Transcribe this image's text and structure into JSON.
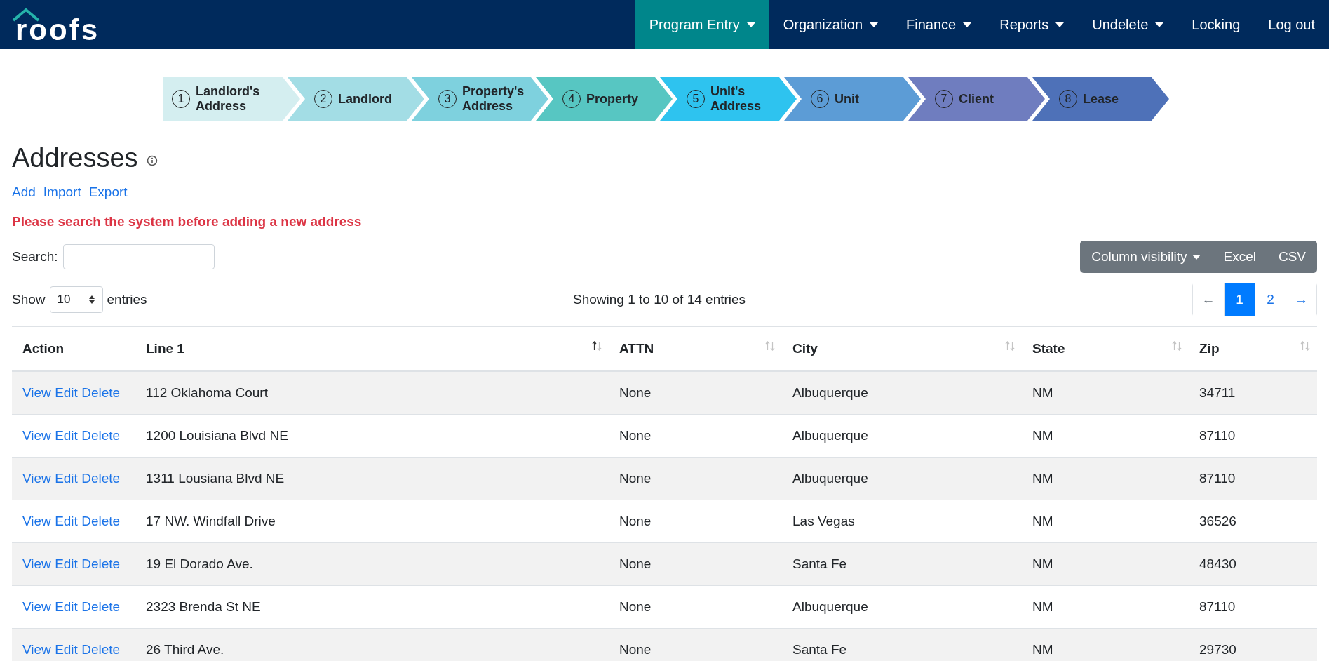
{
  "logo": {
    "text": "roofs"
  },
  "nav": [
    {
      "label": "Program Entry",
      "dropdown": true,
      "selected": true
    },
    {
      "label": "Organization",
      "dropdown": true,
      "selected": false
    },
    {
      "label": "Finance",
      "dropdown": true,
      "selected": false
    },
    {
      "label": "Reports",
      "dropdown": true,
      "selected": false
    },
    {
      "label": "Undelete",
      "dropdown": true,
      "selected": false
    },
    {
      "label": "Locking",
      "dropdown": false,
      "selected": false
    },
    {
      "label": "Log out",
      "dropdown": false,
      "selected": false
    }
  ],
  "steps": [
    {
      "number": "1",
      "label": "Landlord's Address",
      "color": "#d4eef0"
    },
    {
      "number": "2",
      "label": "Landlord",
      "color": "#a3dde5"
    },
    {
      "number": "3",
      "label": "Property's Address",
      "color": "#7ed1de"
    },
    {
      "number": "4",
      "label": "Property",
      "color": "#57c6c2"
    },
    {
      "number": "5",
      "label": "Unit's Address",
      "color": "#2ec3ef"
    },
    {
      "number": "6",
      "label": "Unit",
      "color": "#5c9cd6"
    },
    {
      "number": "7",
      "label": "Client",
      "color": "#6f7dbf"
    },
    {
      "number": "8",
      "label": "Lease",
      "color": "#4e71b8"
    }
  ],
  "heading": "Addresses",
  "actions": [
    "Add",
    "Import",
    "Export"
  ],
  "warning": "Please search the system before adding a new address",
  "search": {
    "label": "Search:"
  },
  "export_buttons": [
    {
      "label": "Column visibility",
      "dropdown": true
    },
    {
      "label": "Excel",
      "dropdown": false
    },
    {
      "label": "CSV",
      "dropdown": false
    }
  ],
  "length": {
    "prefix": "Show",
    "value": "10",
    "suffix": "entries"
  },
  "info": "Showing 1 to 10 of 14 entries",
  "pagination": [
    {
      "label": "←",
      "selected": false,
      "disabled": true
    },
    {
      "label": "1",
      "selected": true,
      "disabled": false
    },
    {
      "label": "2",
      "selected": false,
      "disabled": false
    },
    {
      "label": "→",
      "selected": false,
      "disabled": false
    }
  ],
  "table": {
    "action_column": {
      "label": "Action"
    },
    "columns": [
      {
        "label": "Line 1",
        "sorted_ascending": true
      },
      {
        "label": "ATTN",
        "sorted_ascending": false
      },
      {
        "label": "City",
        "sorted_ascending": false
      },
      {
        "label": "State",
        "sorted_ascending": false
      },
      {
        "label": "Zip",
        "sorted_ascending": false
      }
    ],
    "rows": [
      {
        "links": [
          "View",
          "Edit",
          "Delete"
        ],
        "cells": [
          "112 Oklahoma Court",
          "None",
          "Albuquerque",
          "NM",
          "34711"
        ]
      },
      {
        "links": [
          "View",
          "Edit",
          "Delete"
        ],
        "cells": [
          "1200 Louisiana Blvd NE",
          "None",
          "Albuquerque",
          "NM",
          "87110"
        ]
      },
      {
        "links": [
          "View",
          "Edit",
          "Delete"
        ],
        "cells": [
          "1311 Lousiana Blvd NE",
          "None",
          "Albuquerque",
          "NM",
          "87110"
        ]
      },
      {
        "links": [
          "View",
          "Edit",
          "Delete"
        ],
        "cells": [
          "17 NW. Windfall Drive",
          "None",
          "Las Vegas",
          "NM",
          "36526"
        ]
      },
      {
        "links": [
          "View",
          "Edit",
          "Delete"
        ],
        "cells": [
          "19 El Dorado Ave.",
          "None",
          "Santa Fe",
          "NM",
          "48430"
        ]
      },
      {
        "links": [
          "View",
          "Edit",
          "Delete"
        ],
        "cells": [
          "2323 Brenda St NE",
          "None",
          "Albuquerque",
          "NM",
          "87110"
        ]
      },
      {
        "links": [
          "View",
          "Edit",
          "Delete"
        ],
        "cells": [
          "26 Third Ave.",
          "None",
          "Santa Fe",
          "NM",
          "29730"
        ]
      }
    ]
  }
}
